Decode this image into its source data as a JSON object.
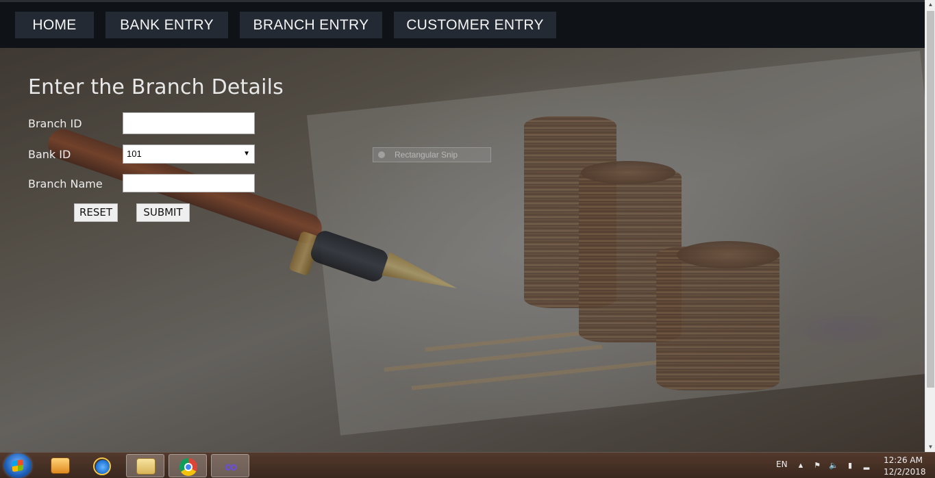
{
  "nav": {
    "items": [
      {
        "label": "HOME"
      },
      {
        "label": "BANK ENTRY"
      },
      {
        "label": "BRANCH ENTRY"
      },
      {
        "label": "CUSTOMER ENTRY"
      }
    ]
  },
  "form": {
    "title": "Enter the Branch Details",
    "branch_id_label": "Branch ID",
    "branch_id_value": "",
    "bank_id_label": "Bank ID",
    "bank_id_selected": "101",
    "branch_name_label": "Branch Name",
    "branch_name_value": "",
    "reset_label": "RESET",
    "submit_label": "SUBMIT"
  },
  "snip": {
    "label": "Rectangular Snip"
  },
  "taskbar": {
    "language": "EN",
    "time": "12:26 AM",
    "date": "12/2/2018",
    "apps": [
      {
        "icon": "media-player-icon"
      },
      {
        "icon": "internet-explorer-icon"
      },
      {
        "icon": "file-explorer-icon"
      },
      {
        "icon": "chrome-icon"
      },
      {
        "icon": "infinity-app-icon"
      }
    ]
  },
  "colors": {
    "navbar_bg": "#0f1217",
    "nav_item_bg": "#232a33",
    "nav_text": "#f4f4f4"
  }
}
